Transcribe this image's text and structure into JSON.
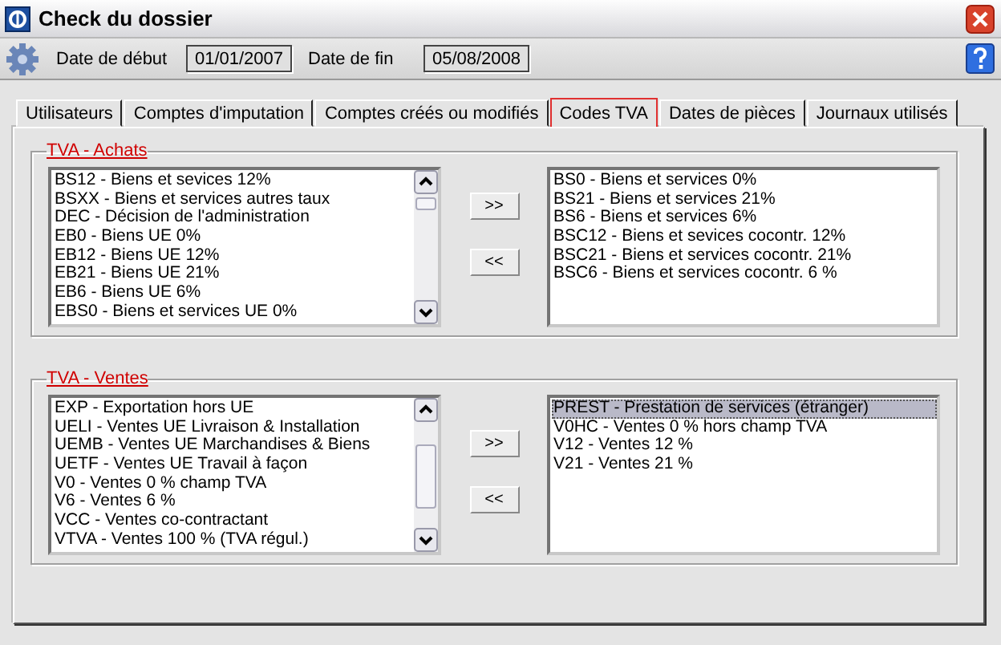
{
  "window": {
    "title": "Check du dossier"
  },
  "toolbar": {
    "start_label": "Date de début",
    "start_value": "01/01/2007",
    "end_label": "Date de fin",
    "end_value": "05/08/2008"
  },
  "tabs": [
    {
      "label": "Utilisateurs",
      "selected": false
    },
    {
      "label": "Comptes d'imputation",
      "selected": false
    },
    {
      "label": "Comptes créés ou modifiés",
      "selected": false
    },
    {
      "label": "Codes TVA",
      "selected": true
    },
    {
      "label": "Dates de pièces",
      "selected": false
    },
    {
      "label": "Journaux utilisés",
      "selected": false
    }
  ],
  "groups": [
    {
      "title": "TVA - Achats",
      "add_button": ">>",
      "remove_button": "<<",
      "available": [
        {
          "label": "BS12 - Biens et sevices 12%",
          "selected": false
        },
        {
          "label": "BSXX - Biens et services autres taux",
          "selected": false
        },
        {
          "label": "DEC - Décision de l'administration",
          "selected": false
        },
        {
          "label": "EB0 - Biens UE 0%",
          "selected": false
        },
        {
          "label": "EB12 - Biens UE 12%",
          "selected": false
        },
        {
          "label": "EB21 - Biens UE 21%",
          "selected": false
        },
        {
          "label": "EB6 - Biens UE 6%",
          "selected": false
        },
        {
          "label": "EBS0 - Biens et services UE 0%",
          "selected": false
        }
      ],
      "chosen": [
        {
          "label": "BS0 - Biens et services 0%",
          "selected": false
        },
        {
          "label": "BS21 - Biens et services 21%",
          "selected": false
        },
        {
          "label": "BS6 - Biens et services 6%",
          "selected": false
        },
        {
          "label": "BSC12 - Biens et sevices cocontr. 12%",
          "selected": false
        },
        {
          "label": "BSC21 - Biens et services cocontr. 21%",
          "selected": false
        },
        {
          "label": "BSC6 - Biens et services cocontr. 6 %",
          "selected": false
        }
      ]
    },
    {
      "title": "TVA - Ventes",
      "add_button": ">>",
      "remove_button": "<<",
      "available": [
        {
          "label": "EXP - Exportation hors UE",
          "selected": false
        },
        {
          "label": "UELI - Ventes UE Livraison & Installation",
          "selected": false
        },
        {
          "label": "UEMB - Ventes UE Marchandises & Biens",
          "selected": false
        },
        {
          "label": "UETF - Ventes UE Travail à façon",
          "selected": false
        },
        {
          "label": "V0 - Ventes 0 % champ TVA",
          "selected": false
        },
        {
          "label": "V6 - Ventes 6 %",
          "selected": false
        },
        {
          "label": "VCC - Ventes co-contractant",
          "selected": false
        },
        {
          "label": "VTVA - Ventes 100 % (TVA régul.)",
          "selected": false
        }
      ],
      "chosen": [
        {
          "label": "PREST - Prestation de services (étranger)",
          "selected": true
        },
        {
          "label": "V0HC - Ventes 0 % hors champ TVA",
          "selected": false
        },
        {
          "label": "V12 - Ventes 12 %",
          "selected": false
        },
        {
          "label": "V21 - Ventes 21 %",
          "selected": false
        }
      ]
    }
  ]
}
